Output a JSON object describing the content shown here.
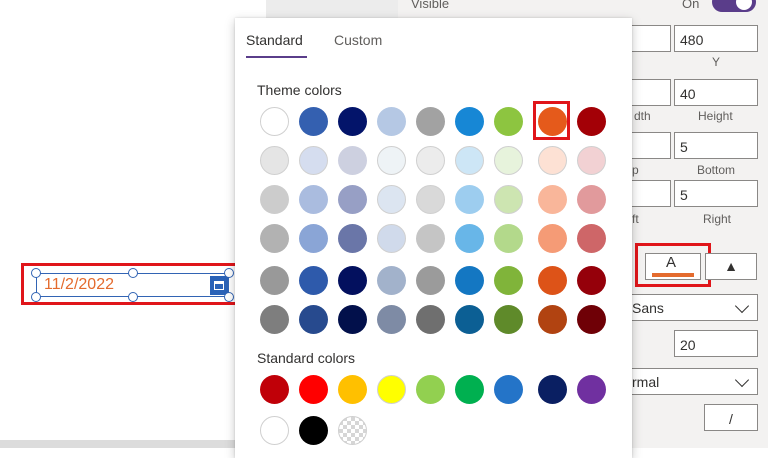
{
  "date_picker": {
    "value": "11/2/2022",
    "icon": "calendar-icon"
  },
  "color_picker": {
    "tabs": [
      "Standard",
      "Custom"
    ],
    "active_tab": "Standard",
    "theme_label": "Theme colors",
    "standard_label": "Standard colors",
    "selected_color": "#e55a1b",
    "theme_rows": [
      [
        "#ffffff",
        "#3460b0",
        "#03146a",
        "#b5c8e4",
        "#a2a2a2",
        "#1787d5",
        "#8dc540",
        "#e55a1b",
        "#a30006"
      ],
      [
        "#e5e5e5",
        "#d5ddef",
        "#cdd0e0",
        "#eef3f6",
        "#ececec",
        "#cde6f6",
        "#e7f3dc",
        "#fde1d4",
        "#f2d1d3"
      ],
      [
        "#cccccc",
        "#aabcdf",
        "#979fc5",
        "#dce5f1",
        "#d9d9d9",
        "#9dcdef",
        "#cde5b1",
        "#f9b69a",
        "#e19a9c"
      ],
      [
        "#b2b2b2",
        "#8aa5d6",
        "#6a76a8",
        "#d0daeb",
        "#c5c5c5",
        "#68b6e8",
        "#b3d98b",
        "#f59b76",
        "#ce6668"
      ],
      [
        "#999999",
        "#2e5aab",
        "#03105e",
        "#a2b2cb",
        "#9b9b9b",
        "#1477c2",
        "#80b43a",
        "#dd5318",
        "#95000a"
      ],
      [
        "#7e7e7e",
        "#274a8e",
        "#02104b",
        "#7e8ba5",
        "#6f6f6f",
        "#0c5f94",
        "#5f8a2a",
        "#b14311",
        "#6f0006"
      ]
    ],
    "standard_row1": [
      "#c00008",
      "#ff0000",
      "#ffc000",
      "#ffff00",
      "#92d050",
      "#00b050",
      "#2474c8",
      "#0a1f62",
      "#7030a0"
    ],
    "standard_row2": [
      "#ffffff",
      "#000000",
      "transparent"
    ]
  },
  "properties": {
    "visible_label": "Visible",
    "visible_value": "On",
    "x_value": "",
    "y_value": "480",
    "y_label": "Y",
    "width_label": "dth",
    "height_value": "40",
    "height_label": "Height",
    "top_label": "p",
    "bottom_value": "5",
    "bottom_label": "Bottom",
    "left_label": "ft",
    "right_value": "5",
    "right_label": "Right",
    "color_label": "A",
    "font_value": "Sans",
    "font_size_value": "20",
    "font_weight_value": "rmal",
    "italic_label": "/"
  },
  "colors": {
    "accent": "#5a3d8a",
    "highlight": "#e0151a",
    "date_text": "#e46b2e"
  }
}
